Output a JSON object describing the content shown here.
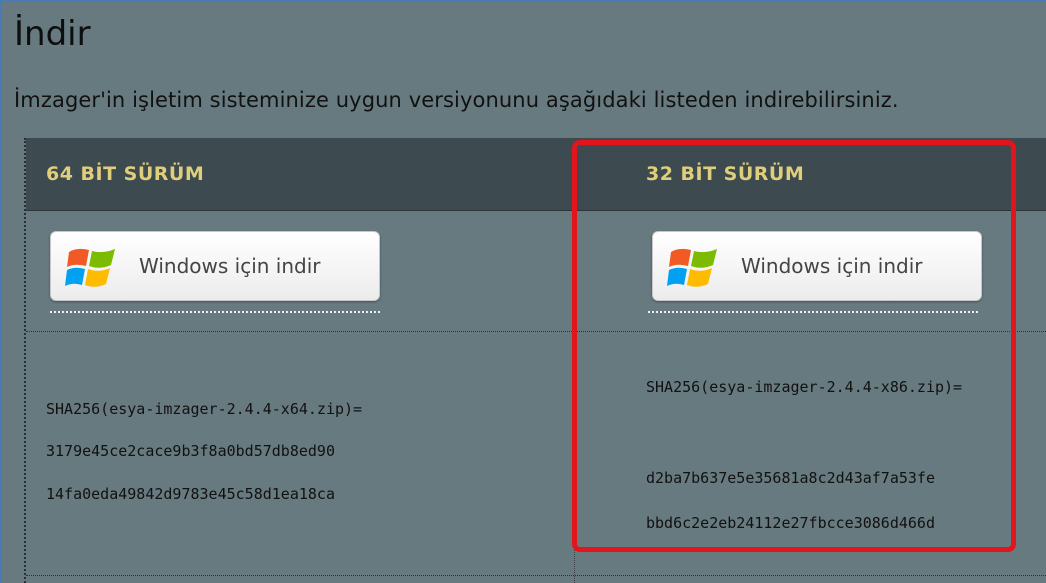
{
  "page": {
    "title": "İndir",
    "intro": "İmzager'in işletim sisteminize uygun versiyonunu aşağıdaki listeden indirebilirsiniz."
  },
  "columns": [
    {
      "header": "64 BİT SÜRÜM",
      "button_label": "Windows için indir",
      "hash_file": "SHA256(esya-imzager-2.4.4-x64.zip)=",
      "hash_line1": "3179e45ce2cace9b3f8a0bd57db8ed90",
      "hash_line2": "14fa0eda49842d9783e45c58d1ea18ca"
    },
    {
      "header": "32 BİT SÜRÜM",
      "button_label": "Windows için indir",
      "hash_file": "SHA256(esya-imzager-2.4.4-x86.zip)=",
      "hash_line1": "d2ba7b637e5e35681a8c2d43af7a53fe",
      "hash_line2": "bbd6c2e2eb24112e27fbcce3086d466d"
    }
  ],
  "colors": {
    "background": "#677a80",
    "header_bg": "#3d4a4f",
    "header_text": "#e0cf7a",
    "highlight": "#e3141b"
  },
  "icons": {
    "button_icon": "windows-logo-icon"
  }
}
